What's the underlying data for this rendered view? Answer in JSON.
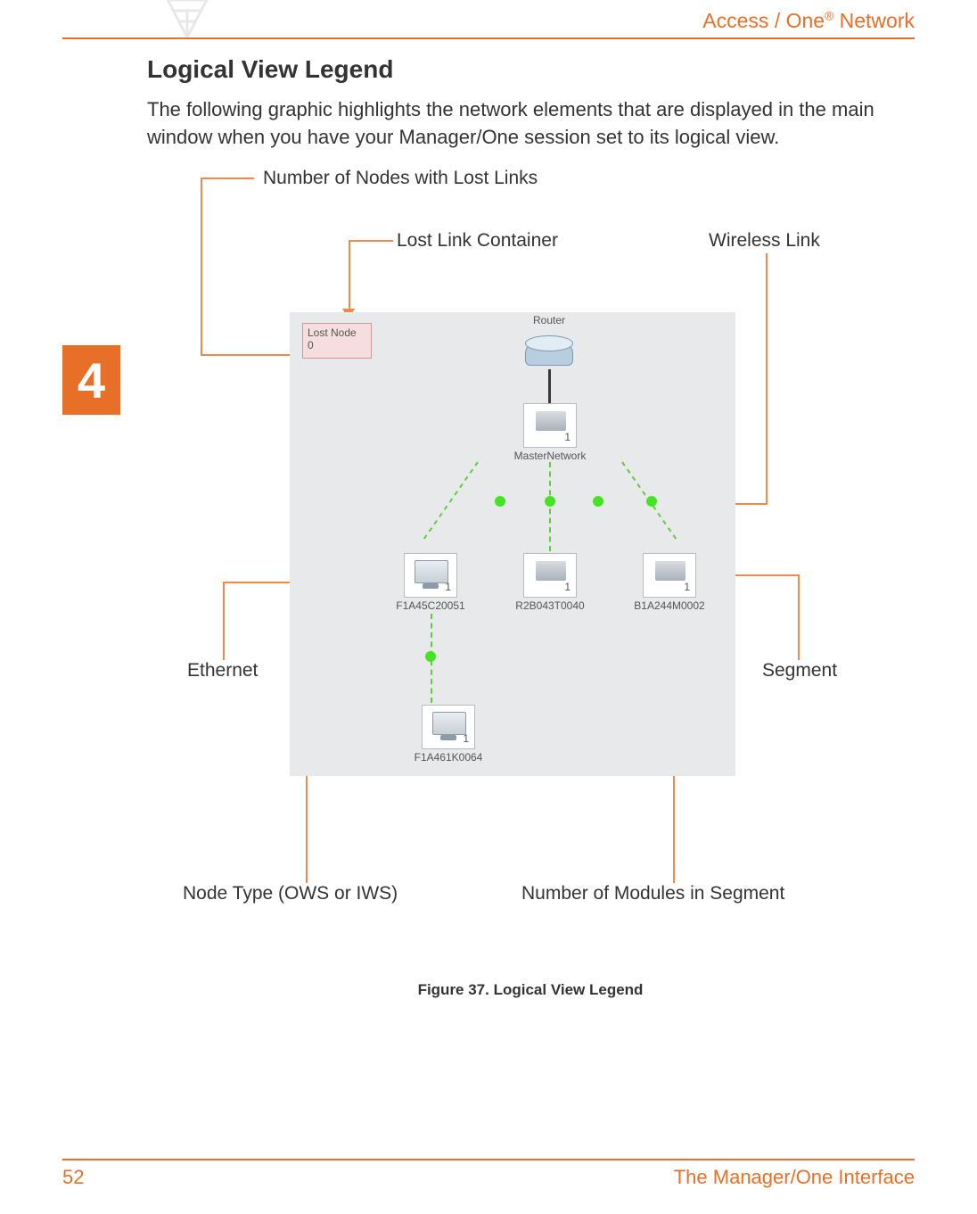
{
  "header": {
    "product_prefix": "Access / One",
    "product_suffix": " Network"
  },
  "section": {
    "heading": "Logical View Legend",
    "paragraph": "The following graphic highlights the network elements that are displayed in the main window when you have your Manager/One session set to its logical view."
  },
  "chapter_tab": "4",
  "callouts": {
    "lost_nodes": "Number of Nodes with Lost Links",
    "lost_link_container": "Lost Link Container",
    "wireless_link": "Wireless Link",
    "ethernet": "Ethernet",
    "segment": "Segment",
    "node_type": "Node Type (OWS or IWS)",
    "modules_in_segment": "Number of Modules in Segment"
  },
  "screenshot": {
    "lost_box_line1": "Lost Node",
    "lost_box_line2": "0",
    "router_label": "Router",
    "master_label": "MasterNetwork",
    "master_count": "1",
    "nodes": {
      "a": {
        "label": "F1A45C20051",
        "count": "1"
      },
      "b": {
        "label": "R2B043T0040",
        "count": "1"
      },
      "c": {
        "label": "B1A244M0002",
        "count": "1"
      },
      "d": {
        "label": "F1A461K0064",
        "count": "1"
      }
    }
  },
  "figure_caption": "Figure 37. Logical View Legend",
  "footer": {
    "page": "52",
    "title": "The Manager/One Interface"
  }
}
